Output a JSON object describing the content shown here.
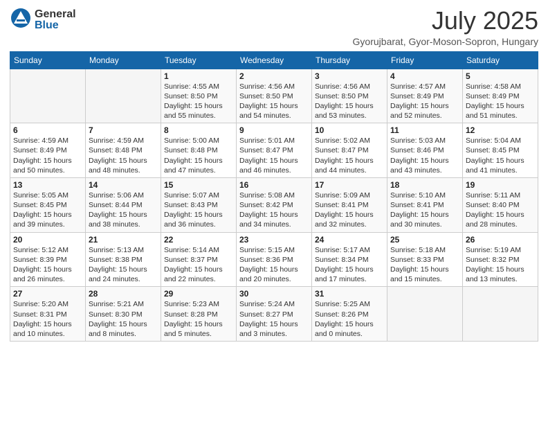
{
  "logo": {
    "general": "General",
    "blue": "Blue"
  },
  "title": {
    "month_year": "July 2025",
    "location": "Gyorujbarat, Gyor-Moson-Sopron, Hungary"
  },
  "headers": [
    "Sunday",
    "Monday",
    "Tuesday",
    "Wednesday",
    "Thursday",
    "Friday",
    "Saturday"
  ],
  "weeks": [
    [
      {
        "day": "",
        "sunrise": "",
        "sunset": "",
        "daylight": ""
      },
      {
        "day": "",
        "sunrise": "",
        "sunset": "",
        "daylight": ""
      },
      {
        "day": "1",
        "sunrise": "Sunrise: 4:55 AM",
        "sunset": "Sunset: 8:50 PM",
        "daylight": "Daylight: 15 hours and 55 minutes."
      },
      {
        "day": "2",
        "sunrise": "Sunrise: 4:56 AM",
        "sunset": "Sunset: 8:50 PM",
        "daylight": "Daylight: 15 hours and 54 minutes."
      },
      {
        "day": "3",
        "sunrise": "Sunrise: 4:56 AM",
        "sunset": "Sunset: 8:50 PM",
        "daylight": "Daylight: 15 hours and 53 minutes."
      },
      {
        "day": "4",
        "sunrise": "Sunrise: 4:57 AM",
        "sunset": "Sunset: 8:49 PM",
        "daylight": "Daylight: 15 hours and 52 minutes."
      },
      {
        "day": "5",
        "sunrise": "Sunrise: 4:58 AM",
        "sunset": "Sunset: 8:49 PM",
        "daylight": "Daylight: 15 hours and 51 minutes."
      }
    ],
    [
      {
        "day": "6",
        "sunrise": "Sunrise: 4:59 AM",
        "sunset": "Sunset: 8:49 PM",
        "daylight": "Daylight: 15 hours and 50 minutes."
      },
      {
        "day": "7",
        "sunrise": "Sunrise: 4:59 AM",
        "sunset": "Sunset: 8:48 PM",
        "daylight": "Daylight: 15 hours and 48 minutes."
      },
      {
        "day": "8",
        "sunrise": "Sunrise: 5:00 AM",
        "sunset": "Sunset: 8:48 PM",
        "daylight": "Daylight: 15 hours and 47 minutes."
      },
      {
        "day": "9",
        "sunrise": "Sunrise: 5:01 AM",
        "sunset": "Sunset: 8:47 PM",
        "daylight": "Daylight: 15 hours and 46 minutes."
      },
      {
        "day": "10",
        "sunrise": "Sunrise: 5:02 AM",
        "sunset": "Sunset: 8:47 PM",
        "daylight": "Daylight: 15 hours and 44 minutes."
      },
      {
        "day": "11",
        "sunrise": "Sunrise: 5:03 AM",
        "sunset": "Sunset: 8:46 PM",
        "daylight": "Daylight: 15 hours and 43 minutes."
      },
      {
        "day": "12",
        "sunrise": "Sunrise: 5:04 AM",
        "sunset": "Sunset: 8:45 PM",
        "daylight": "Daylight: 15 hours and 41 minutes."
      }
    ],
    [
      {
        "day": "13",
        "sunrise": "Sunrise: 5:05 AM",
        "sunset": "Sunset: 8:45 PM",
        "daylight": "Daylight: 15 hours and 39 minutes."
      },
      {
        "day": "14",
        "sunrise": "Sunrise: 5:06 AM",
        "sunset": "Sunset: 8:44 PM",
        "daylight": "Daylight: 15 hours and 38 minutes."
      },
      {
        "day": "15",
        "sunrise": "Sunrise: 5:07 AM",
        "sunset": "Sunset: 8:43 PM",
        "daylight": "Daylight: 15 hours and 36 minutes."
      },
      {
        "day": "16",
        "sunrise": "Sunrise: 5:08 AM",
        "sunset": "Sunset: 8:42 PM",
        "daylight": "Daylight: 15 hours and 34 minutes."
      },
      {
        "day": "17",
        "sunrise": "Sunrise: 5:09 AM",
        "sunset": "Sunset: 8:41 PM",
        "daylight": "Daylight: 15 hours and 32 minutes."
      },
      {
        "day": "18",
        "sunrise": "Sunrise: 5:10 AM",
        "sunset": "Sunset: 8:41 PM",
        "daylight": "Daylight: 15 hours and 30 minutes."
      },
      {
        "day": "19",
        "sunrise": "Sunrise: 5:11 AM",
        "sunset": "Sunset: 8:40 PM",
        "daylight": "Daylight: 15 hours and 28 minutes."
      }
    ],
    [
      {
        "day": "20",
        "sunrise": "Sunrise: 5:12 AM",
        "sunset": "Sunset: 8:39 PM",
        "daylight": "Daylight: 15 hours and 26 minutes."
      },
      {
        "day": "21",
        "sunrise": "Sunrise: 5:13 AM",
        "sunset": "Sunset: 8:38 PM",
        "daylight": "Daylight: 15 hours and 24 minutes."
      },
      {
        "day": "22",
        "sunrise": "Sunrise: 5:14 AM",
        "sunset": "Sunset: 8:37 PM",
        "daylight": "Daylight: 15 hours and 22 minutes."
      },
      {
        "day": "23",
        "sunrise": "Sunrise: 5:15 AM",
        "sunset": "Sunset: 8:36 PM",
        "daylight": "Daylight: 15 hours and 20 minutes."
      },
      {
        "day": "24",
        "sunrise": "Sunrise: 5:17 AM",
        "sunset": "Sunset: 8:34 PM",
        "daylight": "Daylight: 15 hours and 17 minutes."
      },
      {
        "day": "25",
        "sunrise": "Sunrise: 5:18 AM",
        "sunset": "Sunset: 8:33 PM",
        "daylight": "Daylight: 15 hours and 15 minutes."
      },
      {
        "day": "26",
        "sunrise": "Sunrise: 5:19 AM",
        "sunset": "Sunset: 8:32 PM",
        "daylight": "Daylight: 15 hours and 13 minutes."
      }
    ],
    [
      {
        "day": "27",
        "sunrise": "Sunrise: 5:20 AM",
        "sunset": "Sunset: 8:31 PM",
        "daylight": "Daylight: 15 hours and 10 minutes."
      },
      {
        "day": "28",
        "sunrise": "Sunrise: 5:21 AM",
        "sunset": "Sunset: 8:30 PM",
        "daylight": "Daylight: 15 hours and 8 minutes."
      },
      {
        "day": "29",
        "sunrise": "Sunrise: 5:23 AM",
        "sunset": "Sunset: 8:28 PM",
        "daylight": "Daylight: 15 hours and 5 minutes."
      },
      {
        "day": "30",
        "sunrise": "Sunrise: 5:24 AM",
        "sunset": "Sunset: 8:27 PM",
        "daylight": "Daylight: 15 hours and 3 minutes."
      },
      {
        "day": "31",
        "sunrise": "Sunrise: 5:25 AM",
        "sunset": "Sunset: 8:26 PM",
        "daylight": "Daylight: 15 hours and 0 minutes."
      },
      {
        "day": "",
        "sunrise": "",
        "sunset": "",
        "daylight": ""
      },
      {
        "day": "",
        "sunrise": "",
        "sunset": "",
        "daylight": ""
      }
    ]
  ]
}
